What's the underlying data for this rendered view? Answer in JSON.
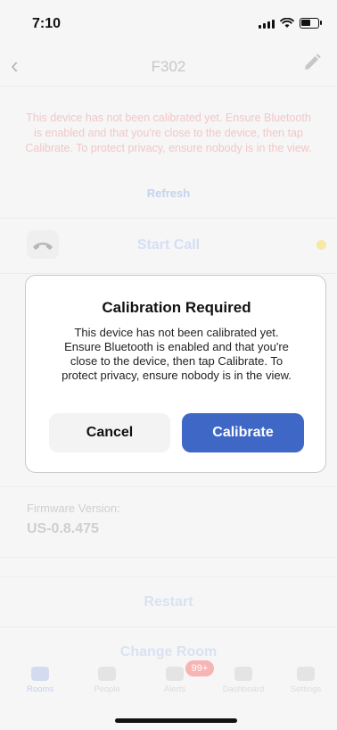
{
  "status_bar": {
    "time": "7:10"
  },
  "nav": {
    "title": "F302",
    "back_icon": "chevron-left-icon",
    "edit_icon": "pencil-icon"
  },
  "background": {
    "calibration_message": "This device has not been calibrated yet. Ensure Bluetooth is enabled and that you're close to the device, then tap Calibrate. To protect privacy, ensure nobody is in the view.",
    "refresh_label": "Refresh",
    "start_call_label": "Start Call",
    "firmware_label": "Firmware Version:",
    "firmware_value": "US-0.8.475",
    "restart_label": "Restart",
    "change_room_label": "Change Room"
  },
  "dialog": {
    "title": "Calibration Required",
    "message": "This device has not been calibrated yet. Ensure Bluetooth is enabled and that you're close to the device, then tap Calibrate. To protect privacy, ensure nobody is in the view.",
    "cancel_label": "Cancel",
    "confirm_label": "Calibrate"
  },
  "tabbar": {
    "items": [
      {
        "label": "Rooms",
        "icon": "bed-icon",
        "active": true
      },
      {
        "label": "People",
        "icon": "person-icon",
        "active": false
      },
      {
        "label": "Alerts",
        "icon": "bell-icon",
        "active": false
      },
      {
        "label": "Dashboard",
        "icon": "chart-icon",
        "active": false
      },
      {
        "label": "Settings",
        "icon": "gear-icon",
        "active": false
      }
    ],
    "alerts_badge": "99+"
  },
  "colors": {
    "accent": "#3f67c6",
    "alert_text": "#f2c7c7",
    "status_dot": "#f5e9a7"
  }
}
